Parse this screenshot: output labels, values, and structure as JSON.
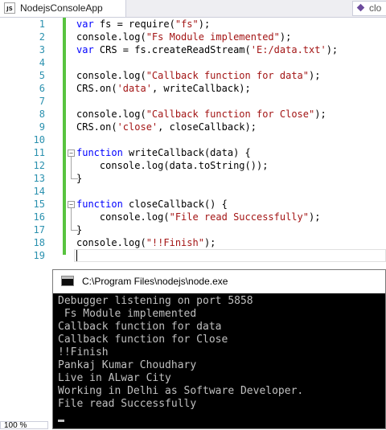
{
  "tab": {
    "icon": "JS",
    "title": "NodejsConsoleApp"
  },
  "member_combo": {
    "text": "clo",
    "icon": "method-icon"
  },
  "editor": {
    "line_numbers": [
      "1",
      "2",
      "3",
      "4",
      "5",
      "6",
      "7",
      "8",
      "9",
      "10",
      "11",
      "12",
      "13",
      "14",
      "15",
      "16",
      "17",
      "18",
      "19"
    ],
    "lines": [
      [
        {
          "t": "var",
          "c": "kw"
        },
        {
          "t": " fs = require("
        },
        {
          "t": "\"fs\"",
          "c": "str"
        },
        {
          "t": ");"
        }
      ],
      [
        {
          "t": "console.log("
        },
        {
          "t": "\"Fs Module implemented\"",
          "c": "str"
        },
        {
          "t": ");"
        }
      ],
      [
        {
          "t": "var",
          "c": "kw"
        },
        {
          "t": " CRS = fs.createReadStream("
        },
        {
          "t": "'E:/data.txt'",
          "c": "str"
        },
        {
          "t": ");"
        }
      ],
      [],
      [
        {
          "t": "console.log("
        },
        {
          "t": "\"Callback function for data\"",
          "c": "str"
        },
        {
          "t": ");"
        }
      ],
      [
        {
          "t": "CRS.on("
        },
        {
          "t": "'data'",
          "c": "str"
        },
        {
          "t": ", writeCallback);"
        }
      ],
      [],
      [
        {
          "t": "console.log("
        },
        {
          "t": "\"Callback function for Close\"",
          "c": "str"
        },
        {
          "t": ");"
        }
      ],
      [
        {
          "t": "CRS.on("
        },
        {
          "t": "'close'",
          "c": "str"
        },
        {
          "t": ", closeCallback);"
        }
      ],
      [],
      [
        {
          "t": "function",
          "c": "kw"
        },
        {
          "t": " writeCallback(data) {"
        }
      ],
      [
        {
          "t": "    console.log(data.toString());"
        }
      ],
      [
        {
          "t": "}"
        }
      ],
      [],
      [
        {
          "t": "function",
          "c": "kw"
        },
        {
          "t": " closeCallback() {"
        }
      ],
      [
        {
          "t": "    console.log("
        },
        {
          "t": "\"File read Successfully\"",
          "c": "str"
        },
        {
          "t": ");"
        }
      ],
      [
        {
          "t": "}"
        }
      ],
      [
        {
          "t": "console.log("
        },
        {
          "t": "\"!!Finish\"",
          "c": "str"
        },
        {
          "t": ");"
        }
      ],
      []
    ]
  },
  "zoom": {
    "label": "100 %"
  },
  "console": {
    "title": "C:\\Program Files\\nodejs\\node.exe",
    "output": [
      "Debugger listening on port 5858",
      " Fs Module implemented",
      "Callback function for data",
      "Callback function for Close",
      "!!Finish",
      "Pankaj Kumar Choudhary",
      "Live in ALwar City",
      "Working in Delhi as Software Developer.",
      "File read Successfully"
    ]
  }
}
